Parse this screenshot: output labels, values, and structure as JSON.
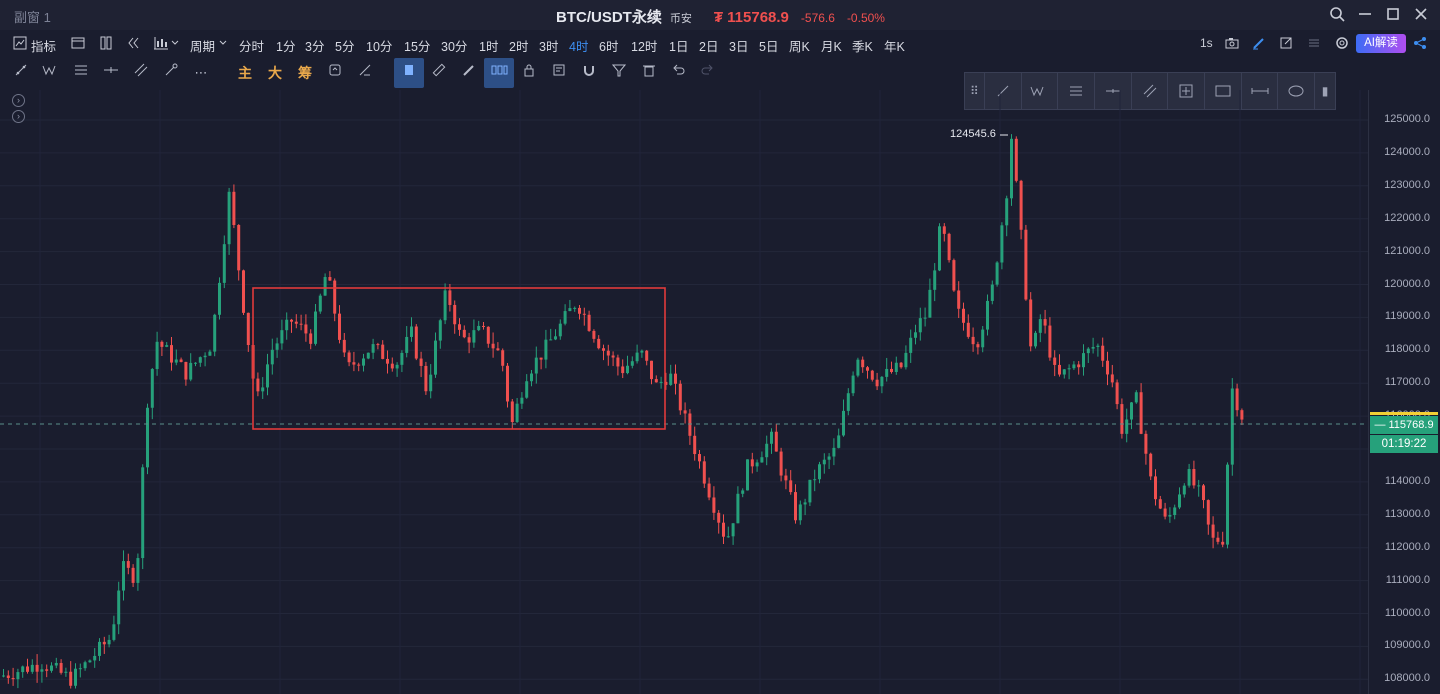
{
  "window": {
    "title": "副窗 1",
    "symbol": "BTC/USDT永续",
    "exchange": "币安",
    "price": "₮ 115768.9",
    "change": "-576.6",
    "change_pct": "-0.50%"
  },
  "toolbar": {
    "indicator_label": "指标",
    "period_label": "周期",
    "timeframes": [
      "分时",
      "1分",
      "3分",
      "5分",
      "10分",
      "15分",
      "30分",
      "1时",
      "2时",
      "3时",
      "4时",
      "6时",
      "12时",
      "1日",
      "2日",
      "3日",
      "5日",
      "周K",
      "月K",
      "季K",
      "年K"
    ],
    "active_timeframe": "4时",
    "refresh_interval": "1s",
    "ai_button": "AI解读"
  },
  "drawing_toolbar": {
    "main_label": "主",
    "big_label": "大",
    "chips_label": "筹"
  },
  "chart": {
    "peak_label": "124545.6",
    "y_ticks": [
      "125000.0",
      "124000.0",
      "123000.0",
      "122000.0",
      "121000.0",
      "120000.0",
      "119000.0",
      "118000.0",
      "117000.0",
      "116000.0",
      "114000.0",
      "113000.0",
      "112000.0",
      "111000.0",
      "110000.0",
      "109000.0",
      "108000.0"
    ],
    "current_price_tag": "— 115768.9",
    "countdown": "01:19:22",
    "colors": {
      "up": "#26a17b",
      "down": "#f0504f",
      "box": "#e03b3b",
      "bg": "#1a1d2e"
    }
  }
}
